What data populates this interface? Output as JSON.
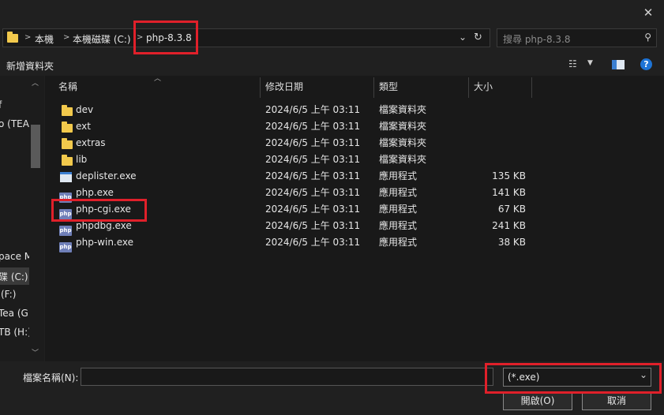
{
  "address": {
    "crumbs": [
      "本機",
      "本機磁碟 (C:)",
      "php-8.3.8"
    ],
    "search_placeholder": "搜尋 php-8.3.8"
  },
  "toolbar": {
    "new_folder_label": "新增資料夾"
  },
  "nav": {
    "items": [
      "f",
      "o (TEA)",
      "pace M",
      "碟 (C:)",
      "(F:)",
      "Tea (G",
      "TB (H:)"
    ]
  },
  "columns": {
    "name": "名稱",
    "modified": "修改日期",
    "type": "類型",
    "size": "大小"
  },
  "files": [
    {
      "name": "dev",
      "date": "2024/6/5 上午 03:11",
      "type": "檔案資料夾",
      "size": "",
      "icon": "folder-icon"
    },
    {
      "name": "ext",
      "date": "2024/6/5 上午 03:11",
      "type": "檔案資料夾",
      "size": "",
      "icon": "folder-icon"
    },
    {
      "name": "extras",
      "date": "2024/6/5 上午 03:11",
      "type": "檔案資料夾",
      "size": "",
      "icon": "folder-icon"
    },
    {
      "name": "lib",
      "date": "2024/6/5 上午 03:11",
      "type": "檔案資料夾",
      "size": "",
      "icon": "folder-icon"
    },
    {
      "name": "deplister.exe",
      "date": "2024/6/5 上午 03:11",
      "type": "應用程式",
      "size": "135 KB",
      "icon": "app-icon"
    },
    {
      "name": "php.exe",
      "date": "2024/6/5 上午 03:11",
      "type": "應用程式",
      "size": "141 KB",
      "icon": "php-icon"
    },
    {
      "name": "php-cgi.exe",
      "date": "2024/6/5 上午 03:11",
      "type": "應用程式",
      "size": "67 KB",
      "icon": "php-icon"
    },
    {
      "name": "phpdbg.exe",
      "date": "2024/6/5 上午 03:11",
      "type": "應用程式",
      "size": "241 KB",
      "icon": "php-icon"
    },
    {
      "name": "php-win.exe",
      "date": "2024/6/5 上午 03:11",
      "type": "應用程式",
      "size": "38 KB",
      "icon": "php-icon"
    }
  ],
  "bottom": {
    "filename_label": "檔案名稱(N):",
    "filename_value": "",
    "filter_value": "(*.exe)",
    "open_label": "開啟(O)",
    "cancel_label": "取消"
  },
  "colors": {
    "highlight": "#e0202a",
    "folder": "#f2c94c"
  }
}
